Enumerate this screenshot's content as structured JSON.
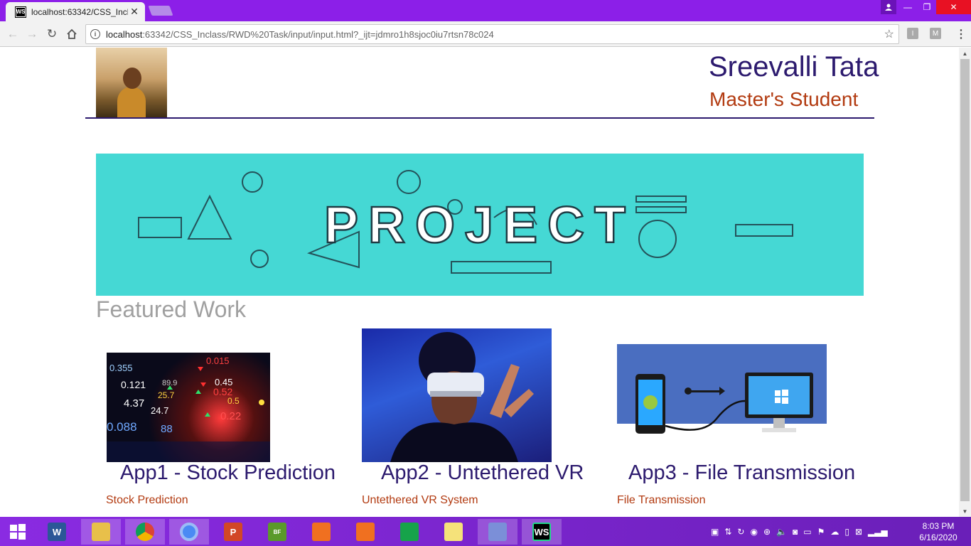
{
  "browser": {
    "tab_title": "localhost:63342/CSS_Incl",
    "tab_favicon": "WS",
    "url_host": "localhost",
    "url_path": ":63342/CSS_Inclass/RWD%20Task/input/input.html?_ijt=jdmro1h8sjoc0iu7rtsn78c024",
    "ext1": "I",
    "ext2": "M"
  },
  "header": {
    "name": "Sreevalli Tata",
    "role": "Master's Student"
  },
  "banner": {
    "text": "PROJECT"
  },
  "section": {
    "title": "Featured Work"
  },
  "cards": [
    {
      "title": "App1 - Stock Prediction",
      "desc": "Stock Prediction"
    },
    {
      "title": "App2 - Untethered VR",
      "desc": "Untethered VR System"
    },
    {
      "title": "App3 - File Transmission",
      "desc": "File Transmission"
    }
  ],
  "stock_numbers": [
    "0.355",
    "0.015",
    "0.121",
    "89.9",
    "0.45",
    "4.37",
    "25.7",
    "0.52",
    "24.7",
    "0.5",
    "0.088",
    "0.22",
    "88"
  ],
  "taskbar": {
    "time": "8:03 PM",
    "date": "6/16/2020",
    "apps": [
      "word",
      "file-explorer",
      "chrome",
      "chrome",
      "powerpoint",
      "big-farm",
      "photo-app",
      "camera-app",
      "store",
      "sticky-notes",
      "task-app",
      "webstorm"
    ]
  },
  "colors": {
    "accent": "#8c1fe8",
    "name": "#2c1a6e",
    "subtitle": "#b23a10",
    "banner": "#45d8d4"
  }
}
